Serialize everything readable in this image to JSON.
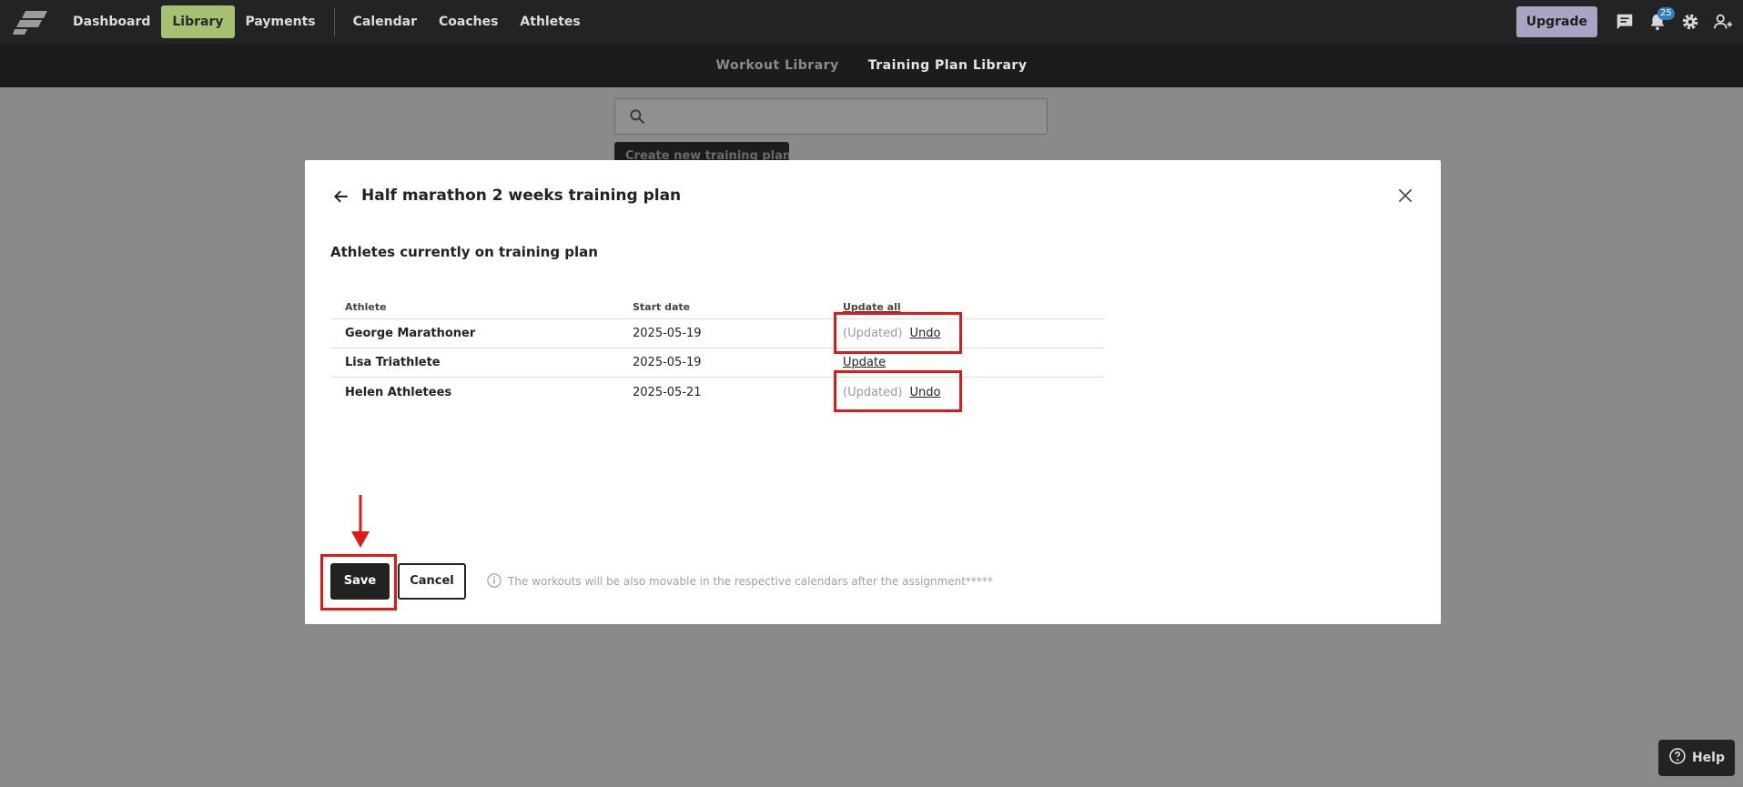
{
  "topnav": {
    "items": [
      {
        "label": "Dashboard"
      },
      {
        "label": "Library"
      },
      {
        "label": "Payments"
      },
      {
        "label": "Calendar"
      },
      {
        "label": "Coaches"
      },
      {
        "label": "Athletes"
      }
    ],
    "upgrade_label": "Upgrade",
    "notification_count": "25",
    "accent_color": "#a7c071"
  },
  "subnav": {
    "tabs": [
      {
        "label": "Workout Library"
      },
      {
        "label": "Training Plan Library"
      }
    ]
  },
  "background": {
    "search_placeholder": "",
    "create_button_label": "Create new training plan"
  },
  "modal": {
    "title": "Half marathon 2 weeks training plan",
    "section_title": "Athletes currently on training plan",
    "columns": {
      "athlete": "Athlete",
      "start_date": "Start date",
      "update_all": "Update all"
    },
    "rows": [
      {
        "athlete": "George Marathoner",
        "start_date": "2025-05-19",
        "status": "(Updated)",
        "action": "Undo"
      },
      {
        "athlete": "Lisa Triathlete",
        "start_date": "2025-05-19",
        "status": "",
        "action": "Update"
      },
      {
        "athlete": "Helen Athletees",
        "start_date": "2025-05-21",
        "status": "(Updated)",
        "action": "Undo"
      }
    ],
    "save_label": "Save",
    "cancel_label": "Cancel",
    "info_note": "The workouts will be also movable in the respective calendars after the assignment*****"
  },
  "help": {
    "label": "Help"
  },
  "annotation_color": "#e01818"
}
